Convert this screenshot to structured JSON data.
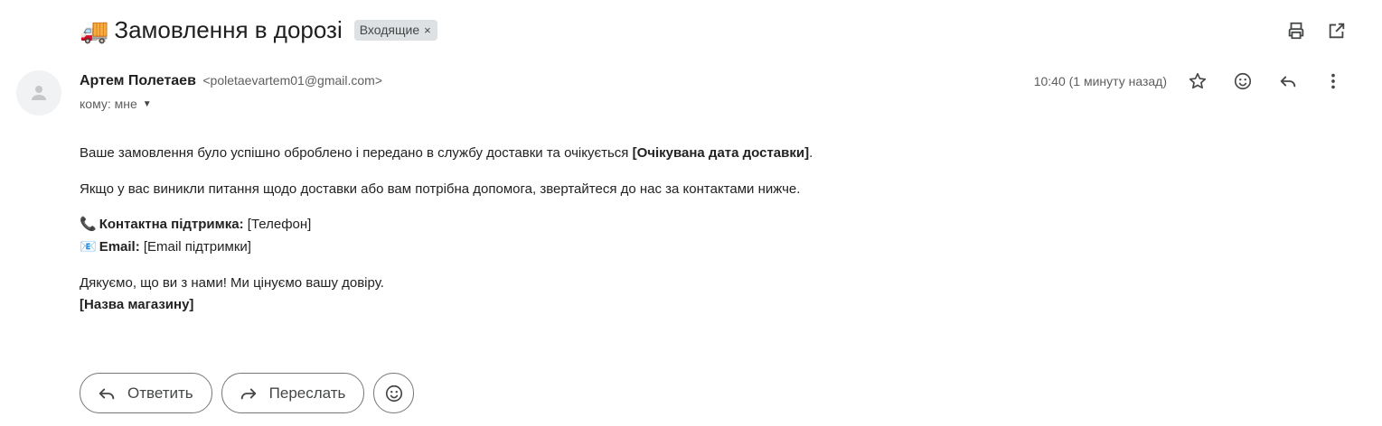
{
  "subject": {
    "emoji": "🚚",
    "title": "Замовлення в дорозі",
    "label": "Входящие",
    "label_remove": "×"
  },
  "top_actions": [
    "print-icon",
    "open-in-new-window-icon"
  ],
  "sender": {
    "name": "Артем Полетаев",
    "email": "<poletaevartem01@gmail.com>",
    "to": "кому: мне"
  },
  "meta": {
    "time": "10:40 (1 минуту назад)",
    "icons": [
      "star-icon",
      "emoji-icon",
      "reply-icon",
      "more-vert-icon"
    ]
  },
  "body": {
    "p1_text": "Ваше замовлення було успішно оброблено і передано в службу доставки та очікується ",
    "p1_bold": "[Очікувана дата доставки]",
    "p1_end": ".",
    "p2": "Якщо у вас виникли питання щодо доставки або вам потрібна допомога, звертайтеся до нас за контактами нижче.",
    "support_emoji": "📞",
    "support_label": "Контактна підтримка:",
    "support_value": " [Телефон]",
    "email_emoji": "📧",
    "email_label": "Email:",
    "email_value": " [Email підтримки]",
    "thanks": "Дякуємо, що ви з нами! Ми цінуємо вашу довіру.",
    "store": "[Назва магазину]"
  },
  "buttons": {
    "reply": "Ответить",
    "forward": "Переслать"
  },
  "colors": {
    "chip_bg": "#dde1e4",
    "text": "#202124",
    "muted": "#5e5e5e"
  }
}
